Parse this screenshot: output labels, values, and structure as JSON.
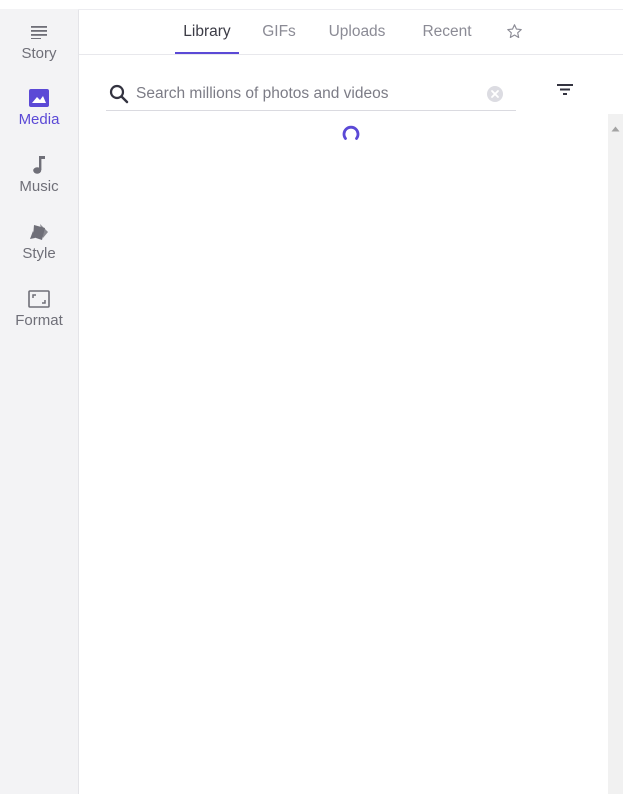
{
  "sidebar": {
    "items": [
      {
        "label": "Story",
        "icon": "lines-icon",
        "active": false
      },
      {
        "label": "Media",
        "icon": "image-icon",
        "active": true
      },
      {
        "label": "Music",
        "icon": "music-note-icon",
        "active": false
      },
      {
        "label": "Style",
        "icon": "style-cards-icon",
        "active": false
      },
      {
        "label": "Format",
        "icon": "aspect-ratio-icon",
        "active": false
      }
    ]
  },
  "tabs": [
    {
      "label": "Library",
      "active": true
    },
    {
      "label": "GIFs",
      "active": false
    },
    {
      "label": "Uploads",
      "active": false
    },
    {
      "label": "Recent",
      "active": false
    }
  ],
  "favorites_icon": "star-outline-icon",
  "search": {
    "value": "",
    "placeholder": "Search millions of photos and videos"
  },
  "colors": {
    "accent": "#5b49d6",
    "sidebar_bg": "#f3f3f5",
    "text_muted": "#8b8b95"
  }
}
